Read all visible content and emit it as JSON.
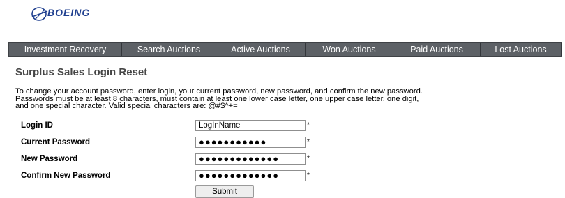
{
  "brand": {
    "logo_text": "BOEING"
  },
  "nav": {
    "items": [
      {
        "label": "Investment Recovery"
      },
      {
        "label": "Search Auctions"
      },
      {
        "label": "Active Auctions"
      },
      {
        "label": "Won Auctions"
      },
      {
        "label": "Paid Auctions"
      },
      {
        "label": "Lost Auctions"
      }
    ]
  },
  "page": {
    "title": "Surplus Sales Login Reset",
    "instructions": "To change your account password, enter login, your current password, new password, and confirm the new password. Passwords must be at least 8 characters, must contain at least one lower case letter, one upper case letter, one digit, and one special character. Valid special characters are: @#$^+="
  },
  "form": {
    "login_id": {
      "label": "Login ID",
      "value": "LogInName",
      "required_mark": "*"
    },
    "current_password": {
      "label": "Current Password",
      "value": "●●●●●●●●●●●",
      "required_mark": "*"
    },
    "new_password": {
      "label": "New Password",
      "value": "●●●●●●●●●●●●●",
      "required_mark": "*"
    },
    "confirm_new_password": {
      "label": "Confirm New Password",
      "value": "●●●●●●●●●●●●●",
      "required_mark": "*"
    },
    "submit_label": "Submit"
  },
  "colors": {
    "nav_bg": "#5d6166",
    "logo_blue": "#1f3f8f",
    "title_gray": "#474747"
  }
}
